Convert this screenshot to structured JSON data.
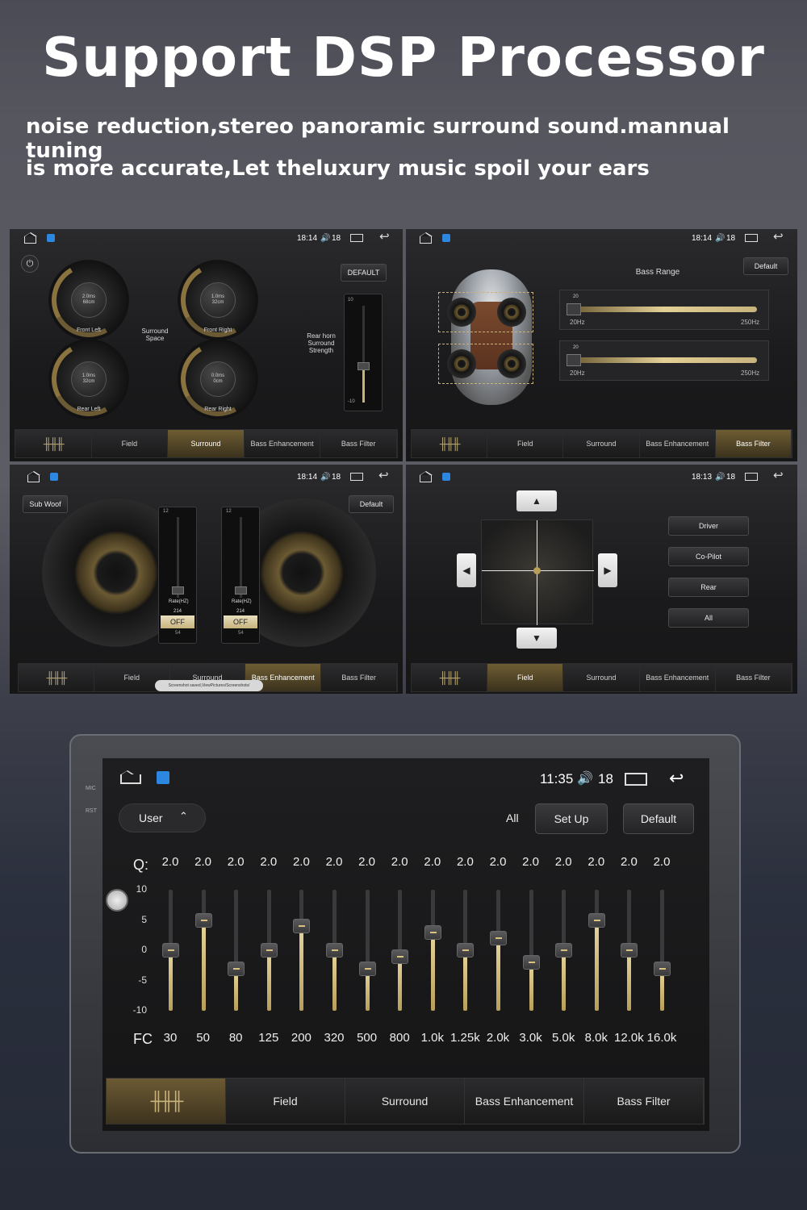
{
  "header": {
    "title": "Support DSP Processor",
    "line1": "noise reduction,stereo panoramic surround sound.mannual tuning",
    "line2": "is more accurate,Let theluxury music spoil your ears"
  },
  "tab_labels": [
    "Field",
    "Surround",
    "Bass Enhancement",
    "Bass Filter"
  ],
  "panel1": {
    "time": "18:14",
    "vol": "18",
    "default_btn": "DEFAULT",
    "surround_space": "Surround Space",
    "rear_horn": "Rear horn Surround Strength",
    "knobs": [
      {
        "label": "Front Left",
        "v1": "2.0ms",
        "v2": "68cm"
      },
      {
        "label": "Front Right",
        "v1": "1.0ms",
        "v2": "32cm"
      },
      {
        "label": "Rear Left",
        "v1": "1.0ms",
        "v2": "32cm"
      },
      {
        "label": "Rear Right",
        "v1": "0.0ms",
        "v2": "0cm"
      }
    ],
    "slider_top": "10",
    "slider_bot": "-10",
    "slider_ticks": [
      "5",
      "0",
      "-5"
    ]
  },
  "panel2": {
    "time": "18:14",
    "vol": "18",
    "default_btn": "Default",
    "bass_range": "Bass Range",
    "sliders": [
      {
        "val": "20",
        "min": "20Hz",
        "max": "250Hz"
      },
      {
        "val": "20",
        "min": "20Hz",
        "max": "250Hz"
      }
    ]
  },
  "panel3": {
    "time": "18:14",
    "vol": "18",
    "sub_woof": "Sub Woof",
    "default_btn": "Default",
    "rate": "Rate(HZ)",
    "rate_val": "214",
    "off": "OFF",
    "sub_val": "54",
    "scale_top": "12",
    "scale_ticks": [
      "9",
      "6",
      "3"
    ],
    "toast": "Screenshot saved,ViewPictures/Screenshots/"
  },
  "panel4": {
    "time": "18:13",
    "vol": "18",
    "buttons": [
      "Driver",
      "Co-Pilot",
      "Rear",
      "All"
    ]
  },
  "eq": {
    "time": "11:35",
    "vol": "18",
    "user": "User",
    "all": "All",
    "setup": "Set Up",
    "default_btn": "Default",
    "q_label": "Q:",
    "fc_label": "FC",
    "q_values": [
      "2.0",
      "2.0",
      "2.0",
      "2.0",
      "2.0",
      "2.0",
      "2.0",
      "2.0",
      "2.0",
      "2.0",
      "2.0",
      "2.0",
      "2.0",
      "2.0",
      "2.0",
      "2.0"
    ],
    "freqs": [
      "30",
      "50",
      "80",
      "125",
      "200",
      "320",
      "500",
      "800",
      "1.0k",
      "1.25k",
      "2.0k",
      "3.0k",
      "5.0k",
      "8.0k",
      "12.0k",
      "16.0k"
    ],
    "gains": [
      0,
      5,
      -3,
      0,
      4,
      0,
      -3,
      -1,
      3,
      0,
      2,
      -2,
      0,
      5,
      0,
      -3
    ],
    "yticks": [
      "10",
      "5",
      "0",
      "-5",
      "-10"
    ],
    "ylim": [
      -10,
      10
    ],
    "accent": "#c9b27a"
  }
}
